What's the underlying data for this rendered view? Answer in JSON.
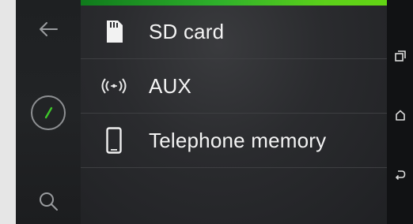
{
  "left_rail": {
    "back_icon": "arrow-left-icon",
    "clock_icon": "clock-icon",
    "search_icon": "search-icon"
  },
  "main": {
    "accent_color": "#3dbf22",
    "items": [
      {
        "label": "SD card",
        "icon": "sd-card-icon"
      },
      {
        "label": "AUX",
        "icon": "aux-signal-icon"
      },
      {
        "label": "Telephone memory",
        "icon": "smartphone-icon"
      }
    ]
  },
  "system_nav": {
    "recents_icon": "recent-apps-icon",
    "home_icon": "home-icon",
    "back_icon": "back-arrow-icon"
  }
}
